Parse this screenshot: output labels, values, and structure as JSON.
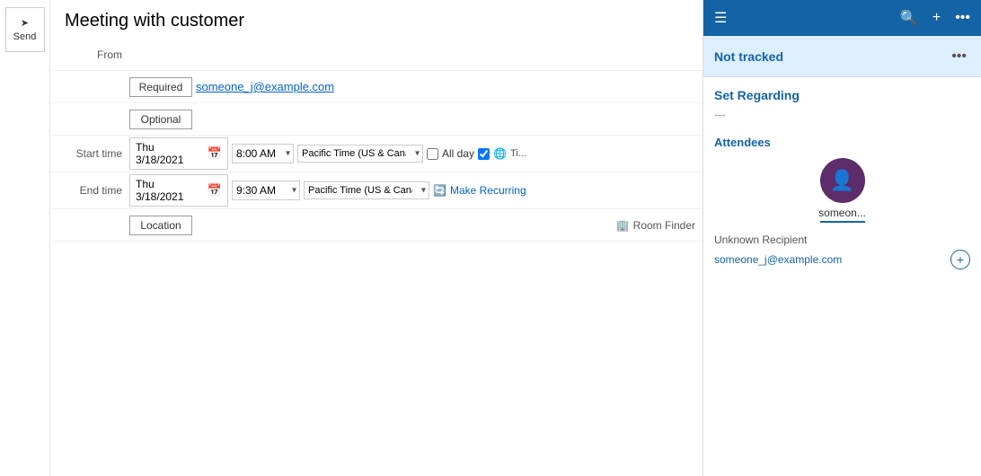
{
  "send_button": {
    "label": "Send",
    "icon": "➤"
  },
  "title": "Meeting with customer",
  "from": {
    "label": "From",
    "value": ""
  },
  "required": {
    "label": "Required",
    "email": "someone_j@example.com"
  },
  "optional": {
    "label": "Optional"
  },
  "start_time": {
    "label": "Start time",
    "date": "Thu 3/18/2021",
    "time": "8:00 AM",
    "timezone": "Pacific Time (US & Cana..."
  },
  "end_time": {
    "label": "End time",
    "date": "Thu 3/18/2021",
    "time": "9:30 AM",
    "timezone": "Pacific Time (US & Cana..."
  },
  "all_day": {
    "label": "All day"
  },
  "recurring": {
    "label": "Make Recurring"
  },
  "location": {
    "label": "Location",
    "placeholder": "",
    "room_finder": "Room Finder"
  },
  "right_panel": {
    "header_icons": {
      "menu": "☰",
      "search": "🔍",
      "add": "+",
      "more": "..."
    },
    "not_tracked": "Not tracked",
    "set_regarding": "Set Regarding",
    "dashes": "---",
    "attendees_heading": "Attendees",
    "attendee": {
      "icon": "👤",
      "name": "someon...",
      "underline": true
    },
    "unknown_recipient": {
      "label": "Unknown Recipient",
      "email": "someone_j@example.com"
    }
  }
}
